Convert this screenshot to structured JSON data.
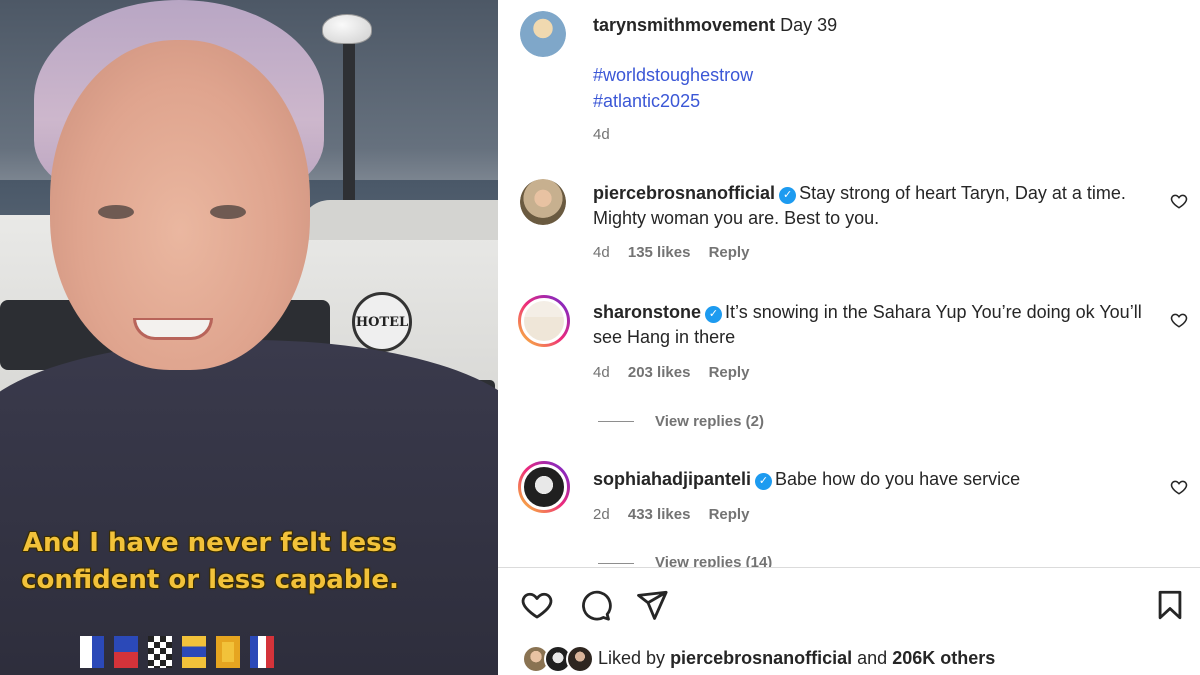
{
  "video": {
    "caption": "And I have never felt less confident or less capable.",
    "sticker_text": "HOTEL"
  },
  "post": {
    "author": "tarynsmithmovement",
    "text": "Day 39",
    "hashtags": [
      "#worldstoughestrow",
      "#atlantic2025"
    ],
    "time": "4d"
  },
  "comments": [
    {
      "username": "piercebrosnanofficial",
      "verified": true,
      "text": "Stay strong of heart Taryn, Day at a time. Mighty woman you are. Best to you.",
      "time": "4d",
      "likes": "135 likes",
      "reply": "Reply"
    },
    {
      "username": "sharonstone",
      "verified": true,
      "text": "It’s snowing in the Sahara Yup You’re doing ok You’ll see Hang in there",
      "time": "4d",
      "likes": "203 likes",
      "reply": "Reply",
      "view_replies": "View replies (2)"
    },
    {
      "username": "sophiahadjipanteli",
      "verified": true,
      "text": "Babe how do you have service",
      "time": "2d",
      "likes": "433 likes",
      "reply": "Reply",
      "view_replies": "View replies (14)"
    }
  ],
  "footer": {
    "liked_by_prefix": "Liked by",
    "liked_by_user": "piercebrosnanofficial",
    "liked_by_and": "and",
    "liked_by_others": "206K others"
  },
  "icons": {
    "like": "heart-icon",
    "comment": "comment-icon",
    "share": "share-icon",
    "save": "bookmark-icon",
    "verified": "verified-badge-icon"
  },
  "colors": {
    "hashtag": "#3b57d6",
    "verified": "#1d9bf0",
    "caption": "#f2c23a",
    "muted": "#737373"
  }
}
